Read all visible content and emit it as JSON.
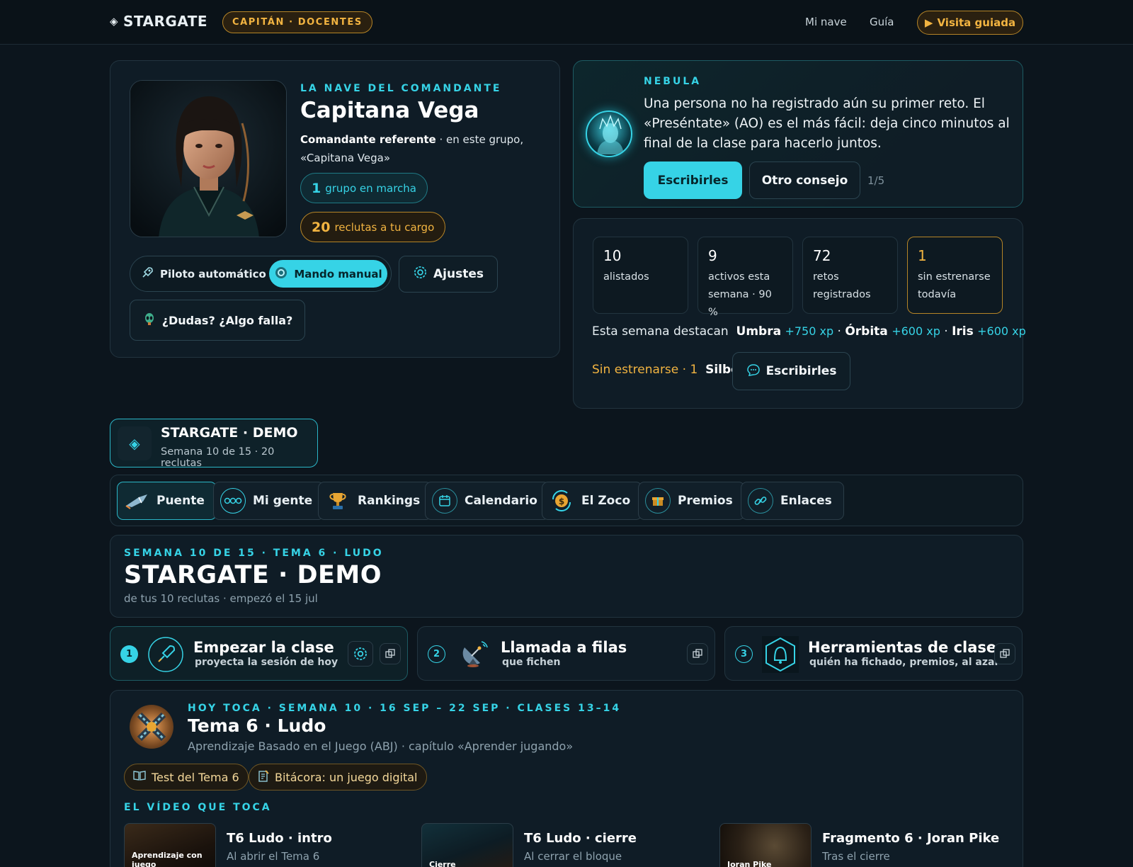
{
  "topbar": {
    "logo": "STARGATE",
    "role": "CAPITÁN · DOCENTES",
    "nav": [
      "Mi nave",
      "Guía"
    ],
    "tour": "Visita guiada"
  },
  "profile": {
    "kicker": "LA NAVE DEL COMANDANTE",
    "name": "Capitana Vega",
    "role_bold": "Comandante referente",
    "role_rest": " · en este grupo, «Capitana Vega»",
    "groups_num": "1",
    "groups_label": "grupo en marcha",
    "recruits_num": "20",
    "recruits_label": "reclutas a tu cargo",
    "mode_auto": "Piloto automático",
    "mode_manual": "Mando manual",
    "settings": "Ajustes",
    "help": "¿Dudas? ¿Algo falla?"
  },
  "nebula": {
    "kicker": "NEBULA",
    "message": "Una persona no ha registrado aún su primer reto. El «Preséntate» (AO) es el más fácil: deja cinco minutos al final de la clase para hacerlo juntos.",
    "primary": "Escribirles",
    "secondary": "Otro consejo",
    "counter": "1/5"
  },
  "stats": {
    "items": [
      {
        "value": "10",
        "label": "alistados"
      },
      {
        "value": "9",
        "label": "activos esta semana · 90 %"
      },
      {
        "value": "72",
        "label": "retos registrados"
      },
      {
        "value": "1",
        "label": "sin estrenarse todavía"
      }
    ],
    "highlights_prefix": "Esta semana destacan",
    "highlights": [
      {
        "name": "Umbra",
        "xp": "+750 xp"
      },
      {
        "name": "Órbita",
        "xp": "+600 xp"
      },
      {
        "name": "Iris",
        "xp": "+600 xp"
      }
    ],
    "untried_label": "Sin estrenarse · 1",
    "untried_name": "Silbo",
    "write": "Escribirles"
  },
  "group": {
    "name": "STARGATE · DEMO",
    "sub": "Semana 10 de 15 · 20 reclutas"
  },
  "tabs": [
    "Puente",
    "Mi gente",
    "Rankings",
    "Calendario",
    "El Zoco",
    "Premios",
    "Enlaces"
  ],
  "week": {
    "kicker": "SEMANA 10 DE 15 · TEMA 6 · LUDO",
    "title": "STARGATE · DEMO",
    "sub": "de tus 10 reclutas · empezó el 15 jul"
  },
  "actions": [
    {
      "num": "1",
      "title": "Empezar la clase",
      "sub": "proyecta la sesión de hoy"
    },
    {
      "num": "2",
      "title": "Llamada a filas",
      "sub": "que fichen"
    },
    {
      "num": "3",
      "title": "Herramientas de clase",
      "sub": "quién ha fichado, premios, al azar"
    }
  ],
  "today": {
    "kicker": "HOY TOCA · SEMANA 10 · 16 SEP – 22 SEP · CLASES 13–14",
    "title": "Tema 6 · Ludo",
    "sub": "Aprendizaje Basado en el Juego (ABJ) · capítulo «Aprender jugando»",
    "chips": [
      "Test del Tema 6",
      "Bitácora: un juego digital"
    ],
    "video_kicker": "EL VÍDEO QUE TOCA",
    "videos": [
      {
        "thumb": "Aprendizaje con juego",
        "title": "T6 Ludo · intro",
        "sub": "Al abrir el Tema 6"
      },
      {
        "thumb": "Cierre",
        "title": "T6 Ludo · cierre",
        "sub": "Al cerrar el bloque"
      },
      {
        "thumb": "Joran Pike",
        "title": "Fragmento 6 · Joran Pike",
        "sub": "Tras el cierre"
      }
    ]
  },
  "colors": {
    "accent": "#36d3e6",
    "amber": "#f2b441",
    "background": "#0c151d",
    "card": "#0f1c26"
  },
  "icons": [
    "diamond-icon",
    "play-icon",
    "rocket-icon",
    "gear-icon",
    "alien-icon",
    "chat-icon",
    "ship-icon",
    "people-icon",
    "trophy-icon",
    "calendar-icon",
    "coin-icon",
    "gift-icon",
    "link-icon",
    "satellite-icon",
    "bell-icon",
    "copy-icon",
    "book-icon",
    "notebook-icon"
  ]
}
